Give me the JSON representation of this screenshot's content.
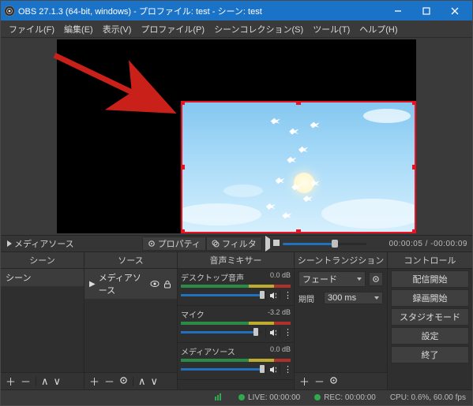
{
  "window": {
    "title": "OBS 27.1.3 (64-bit, windows) - プロファイル: test - シーン: test"
  },
  "menu": {
    "file": "ファイル(F)",
    "edit": "編集(E)",
    "view": "表示(V)",
    "profile": "プロファイル(P)",
    "scene_collection": "シーンコレクション(S)",
    "tools": "ツール(T)",
    "help": "ヘルプ(H)"
  },
  "toolbar": {
    "source_name": "メディアソース",
    "properties": "プロパティ",
    "filters": "フィルタ"
  },
  "transport": {
    "slider_pct": 62,
    "time_current": " 00:00:05",
    "time_total": "-00:00:09"
  },
  "docks": {
    "scenes_header": "シーン",
    "scenes": [
      "シーン"
    ],
    "sources_header": "ソース",
    "sources": [
      {
        "name": "メディアソース",
        "visible": true,
        "locked": false
      }
    ],
    "mixer_header": "音声ミキサー",
    "mixer": [
      {
        "name": "デスクトップ音声",
        "db": "0.0 dB",
        "vol_pct": 100
      },
      {
        "name": "マイク",
        "db": "-3.2 dB",
        "vol_pct": 92
      },
      {
        "name": "メディアソース",
        "db": "0.0 dB",
        "vol_pct": 100
      }
    ],
    "transitions_header": "シーントランジション",
    "transitions": {
      "selected": "フェード",
      "duration_label": "期間",
      "duration_value": "300 ms"
    },
    "controls_header": "コントロール",
    "controls": {
      "start_stream": "配信開始",
      "start_record": "録画開始",
      "studio_mode": "スタジオモード",
      "settings": "設定",
      "exit": "終了"
    }
  },
  "status": {
    "live_label": "LIVE:",
    "live_time": "00:00:00",
    "rec_label": "REC:",
    "rec_time": "00:00:00",
    "cpu": "CPU: 0.6%, 60.00 fps"
  }
}
